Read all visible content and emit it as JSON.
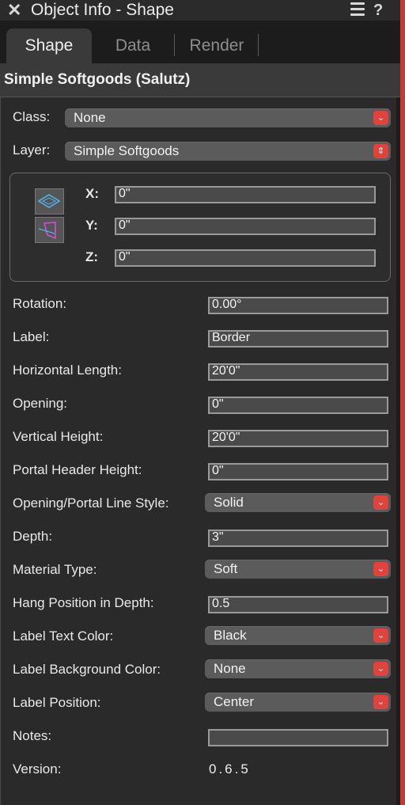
{
  "window": {
    "title": "Object Info - Shape",
    "help_label": "?"
  },
  "tabs": [
    {
      "label": "Shape",
      "active": true
    },
    {
      "label": "Data",
      "active": false
    },
    {
      "label": "Render",
      "active": false
    }
  ],
  "object_name": "Simple Softgoods (Salutz)",
  "class": {
    "label": "Class:",
    "value": "None"
  },
  "layer": {
    "label": "Layer:",
    "value": "Simple Softgoods"
  },
  "coords": {
    "x": {
      "label": "X:",
      "value": "0\""
    },
    "y": {
      "label": "Y:",
      "value": "0\""
    },
    "z": {
      "label": "Z:",
      "value": "0\""
    }
  },
  "fields": {
    "rotation": {
      "label": "Rotation:",
      "value": "0.00°"
    },
    "label": {
      "label": "Label:",
      "value": "Border"
    },
    "horizontal_length": {
      "label": "Horizontal Length:",
      "value": "20'0\""
    },
    "opening": {
      "label": "Opening:",
      "value": "0\""
    },
    "vertical_height": {
      "label": "Vertical Height:",
      "value": "20'0\""
    },
    "portal_header_height": {
      "label": "Portal Header Height:",
      "value": "0\""
    },
    "opening_portal_line_style": {
      "label": "Opening/Portal Line Style:",
      "value": "Solid"
    },
    "depth": {
      "label": "Depth:",
      "value": "3\""
    },
    "material_type": {
      "label": "Material Type:",
      "value": "Soft"
    },
    "hang_position_in_depth": {
      "label": "Hang Position in Depth:",
      "value": "0.5"
    },
    "label_text_color": {
      "label": "Label Text Color:",
      "value": "Black"
    },
    "label_background_color": {
      "label": "Label Background Color:",
      "value": "None"
    },
    "label_position": {
      "label": "Label Position:",
      "value": "Center"
    },
    "notes": {
      "label": "Notes:",
      "value": ""
    },
    "version": {
      "label": "Version:",
      "value": "0.6.5"
    }
  },
  "colors": {
    "accent_popup_arrow": "#e0433b",
    "panel_bg": "#2a2a2a",
    "window_edge": "#c23c33"
  }
}
